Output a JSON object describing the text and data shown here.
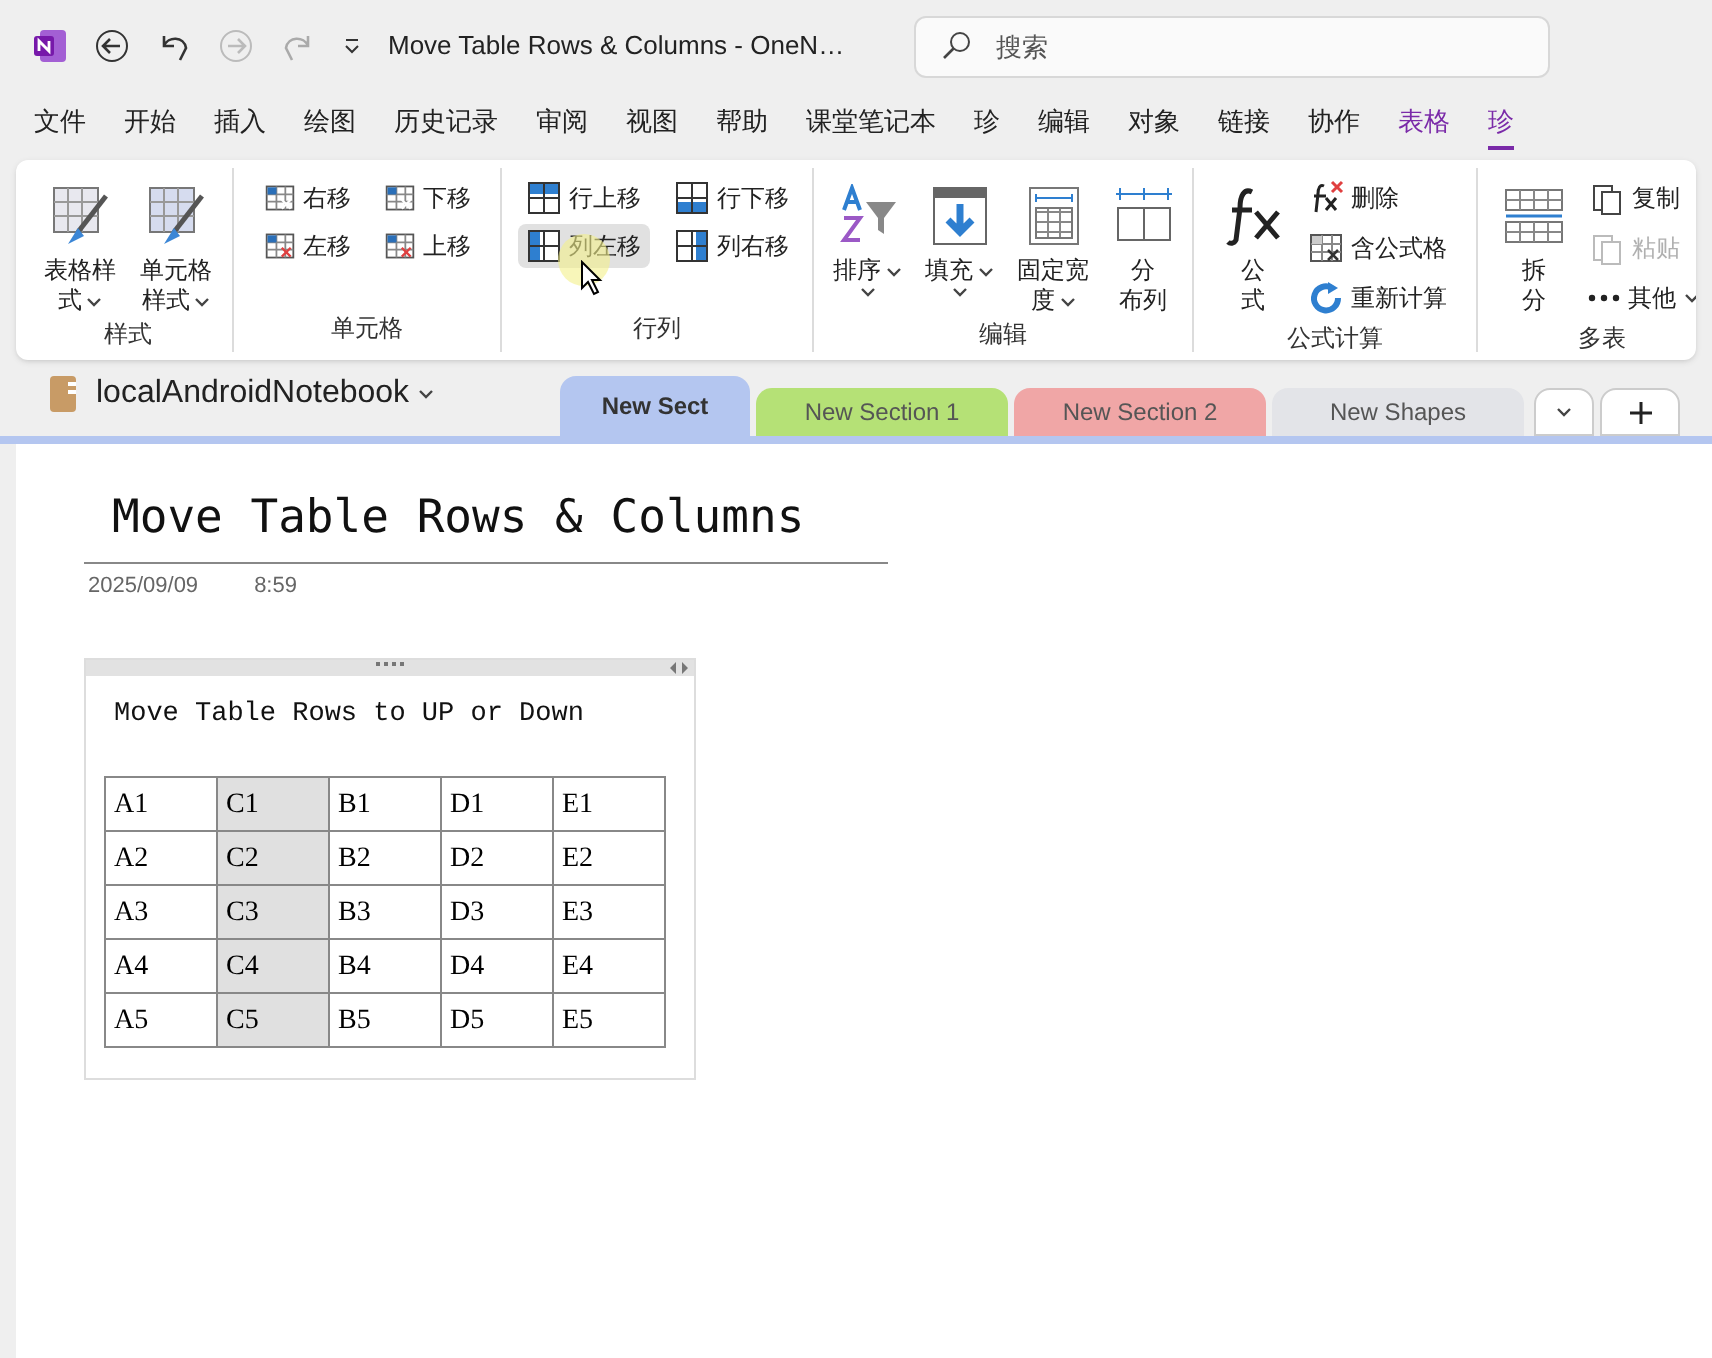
{
  "title_bar": {
    "title": "Move Table Rows & Columns  -  OneN…",
    "search": {
      "placeholder": "搜索"
    }
  },
  "menu_tabs": [
    {
      "label": "文件",
      "selected": false,
      "kind": "normal"
    },
    {
      "label": "开始",
      "selected": false,
      "kind": "normal"
    },
    {
      "label": "插入",
      "selected": false,
      "kind": "normal"
    },
    {
      "label": "绘图",
      "selected": false,
      "kind": "normal"
    },
    {
      "label": "历史记录",
      "selected": false,
      "kind": "normal"
    },
    {
      "label": "审阅",
      "selected": false,
      "kind": "normal"
    },
    {
      "label": "视图",
      "selected": false,
      "kind": "normal"
    },
    {
      "label": "帮助",
      "selected": false,
      "kind": "normal"
    },
    {
      "label": "课堂笔记本",
      "selected": false,
      "kind": "normal"
    },
    {
      "label": "珍",
      "selected": false,
      "kind": "normal"
    },
    {
      "label": "编辑",
      "selected": false,
      "kind": "normal"
    },
    {
      "label": "对象",
      "selected": false,
      "kind": "normal"
    },
    {
      "label": "链接",
      "selected": false,
      "kind": "normal"
    },
    {
      "label": "协作",
      "selected": false,
      "kind": "normal"
    },
    {
      "label": "表格",
      "selected": false,
      "kind": "contextual"
    },
    {
      "label": "珍",
      "selected": true,
      "kind": "contextual"
    }
  ],
  "ribbon_groups": [
    {
      "label": "样式",
      "items": [
        {
          "kind": "large",
          "lines": [
            "表格样",
            "式"
          ],
          "dropdown": true
        },
        {
          "kind": "large",
          "lines": [
            "单元格",
            "样式"
          ],
          "dropdown": true
        }
      ]
    },
    {
      "label": "单元格",
      "items": [
        {
          "kind": "small",
          "label": "右移"
        },
        {
          "kind": "small",
          "label": "左移"
        },
        {
          "kind": "small",
          "label": "下移"
        },
        {
          "kind": "small",
          "label": "上移"
        }
      ]
    },
    {
      "label": "行列",
      "items": [
        {
          "kind": "small",
          "label": "行上移",
          "hovered": false
        },
        {
          "kind": "small",
          "label": "列左移",
          "hovered": true
        },
        {
          "kind": "small",
          "label": "行下移",
          "hovered": false
        },
        {
          "kind": "small",
          "label": "列右移",
          "hovered": false
        }
      ]
    },
    {
      "label": "编辑",
      "items": [
        {
          "kind": "large",
          "lines": [
            "排序"
          ],
          "dropdown": true
        },
        {
          "kind": "large",
          "lines": [
            "填充"
          ],
          "dropdown": true
        },
        {
          "kind": "large",
          "lines": [
            "固定宽",
            "度"
          ],
          "dropdown": true
        },
        {
          "kind": "large",
          "lines": [
            "分",
            "布列"
          ],
          "dropdown": false
        }
      ]
    },
    {
      "label": "公式计算",
      "items": [
        {
          "kind": "large",
          "lines": [
            "公",
            "式"
          ],
          "dropdown": false
        },
        {
          "kind": "small",
          "label": "删除",
          "disabled": false
        },
        {
          "kind": "small",
          "label": "含公式格",
          "disabled": false
        },
        {
          "kind": "small",
          "label": "重新计算",
          "disabled": false
        }
      ]
    },
    {
      "label": "多表",
      "items": [
        {
          "kind": "large",
          "lines": [
            "拆",
            "分"
          ],
          "dropdown": false
        },
        {
          "kind": "small",
          "label": "复制",
          "disabled": false
        },
        {
          "kind": "small",
          "label": "粘贴",
          "disabled": true
        },
        {
          "kind": "small",
          "label": "其他",
          "disabled": false,
          "dropdown": true
        }
      ]
    }
  ],
  "notebook": {
    "name": "localAndroidNotebook"
  },
  "section_tabs": [
    {
      "label": "New Sect",
      "color": "#b4c6f0",
      "selected": true
    },
    {
      "label": "New Section 1",
      "color": "#b5e176",
      "selected": false
    },
    {
      "label": "New Section 2",
      "color": "#f0a6a6",
      "selected": false
    },
    {
      "label": "New Shapes",
      "color": "#e3e4e8",
      "selected": false
    }
  ],
  "page": {
    "title": "Move Table Rows & Columns",
    "date": "2025/09/09",
    "time": "8:59",
    "caption": "Move Table Rows to UP or Down",
    "table": {
      "rows": [
        [
          {
            "text": "A1",
            "selected": false
          },
          {
            "text": "C1",
            "selected": true
          },
          {
            "text": "B1",
            "selected": false
          },
          {
            "text": "D1",
            "selected": false
          },
          {
            "text": "E1",
            "selected": false
          }
        ],
        [
          {
            "text": "A2",
            "selected": false
          },
          {
            "text": "C2",
            "selected": true
          },
          {
            "text": "B2",
            "selected": false
          },
          {
            "text": "D2",
            "selected": false
          },
          {
            "text": "E2",
            "selected": false
          }
        ],
        [
          {
            "text": "A3",
            "selected": false
          },
          {
            "text": "C3",
            "selected": true
          },
          {
            "text": "B3",
            "selected": false
          },
          {
            "text": "D3",
            "selected": false
          },
          {
            "text": "E3",
            "selected": false
          }
        ],
        [
          {
            "text": "A4",
            "selected": false
          },
          {
            "text": "C4",
            "selected": true
          },
          {
            "text": "B4",
            "selected": false
          },
          {
            "text": "D4",
            "selected": false
          },
          {
            "text": "E4",
            "selected": false
          }
        ],
        [
          {
            "text": "A5",
            "selected": false
          },
          {
            "text": "C5",
            "selected": true
          },
          {
            "text": "B5",
            "selected": false
          },
          {
            "text": "D5",
            "selected": false
          },
          {
            "text": "E5",
            "selected": false
          }
        ]
      ]
    }
  }
}
